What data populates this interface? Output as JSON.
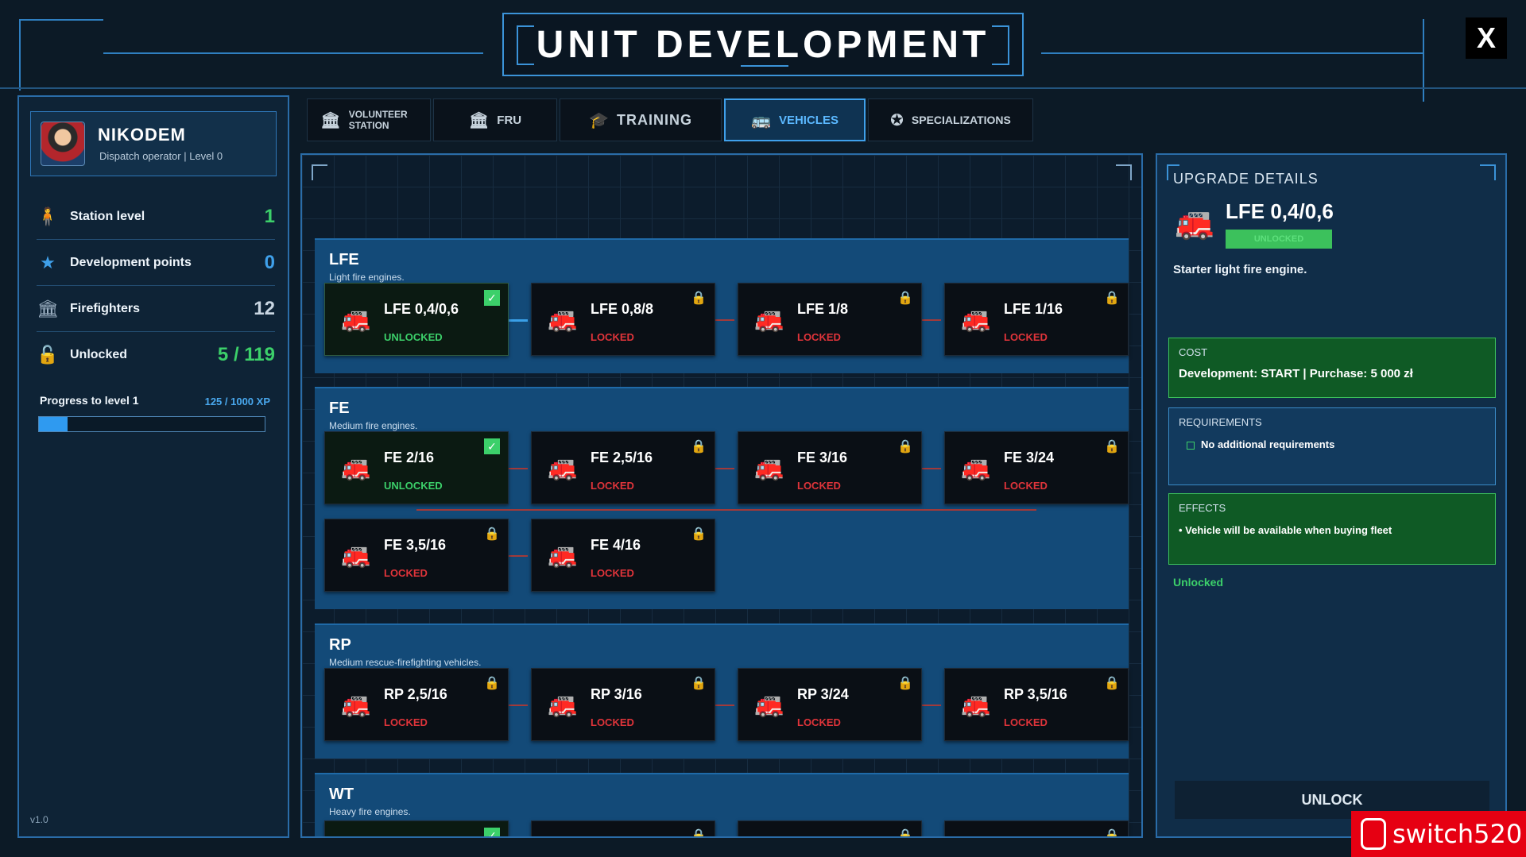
{
  "header": {
    "title": "UNIT DEVELOPMENT",
    "close_label": "X"
  },
  "profile": {
    "name": "NIKODEM",
    "subtitle": "Dispatch operator | Level 0"
  },
  "stats": [
    {
      "label": "Station level",
      "value": "1",
      "color": "#3cd06a",
      "icon": "firefighter-icon"
    },
    {
      "label": "Development points",
      "value": "0",
      "color": "#3fa0ea",
      "icon": "star-icon"
    },
    {
      "label": "Firefighters",
      "value": "12",
      "color": "#c9d6e2",
      "icon": "building-icon"
    },
    {
      "label": "Unlocked",
      "value": "5 / 119",
      "color": "#3cd06a",
      "icon": "lock-open-icon"
    }
  ],
  "progress": {
    "label": "Progress to level 1",
    "xp_text": "125 / 1000 XP",
    "fraction": 0.125
  },
  "version": "v1.0",
  "tabs": [
    {
      "label": "VOLUNTEER STATION",
      "icon": "station-icon",
      "active": false
    },
    {
      "label": "FRU",
      "icon": "station-icon",
      "active": false
    },
    {
      "label": "TRAINING",
      "icon": "graduation-cap-icon",
      "active": false
    },
    {
      "label": "VEHICLES",
      "icon": "bus-icon",
      "active": true
    },
    {
      "label": "SPECIALIZATIONS",
      "icon": "star-badge-icon",
      "active": false
    }
  ],
  "groups": [
    {
      "name": "LFE",
      "desc": "Light fire engines.",
      "nodes": [
        {
          "name": "LFE 0,4/0,6",
          "status": "UNLOCKED",
          "selected": true
        },
        {
          "name": "LFE 0,8/8",
          "status": "LOCKED"
        },
        {
          "name": "LFE 1/8",
          "status": "LOCKED"
        },
        {
          "name": "LFE 1/16",
          "status": "LOCKED"
        }
      ]
    },
    {
      "name": "FE",
      "desc": "Medium fire engines.",
      "nodes": [
        {
          "name": "FE 2/16",
          "status": "UNLOCKED"
        },
        {
          "name": "FE 2,5/16",
          "status": "LOCKED"
        },
        {
          "name": "FE 3/16",
          "status": "LOCKED"
        },
        {
          "name": "FE 3/24",
          "status": "LOCKED"
        },
        {
          "name": "FE 3,5/16",
          "status": "LOCKED"
        },
        {
          "name": "FE 4/16",
          "status": "LOCKED"
        }
      ]
    },
    {
      "name": "RP",
      "desc": "Medium rescue-firefighting vehicles.",
      "nodes": [
        {
          "name": "RP 2,5/16",
          "status": "LOCKED"
        },
        {
          "name": "RP 3/16",
          "status": "LOCKED"
        },
        {
          "name": "RP 3/24",
          "status": "LOCKED"
        },
        {
          "name": "RP 3,5/16",
          "status": "LOCKED"
        }
      ]
    },
    {
      "name": "WT",
      "desc": "Heavy fire engines.",
      "nodes": []
    }
  ],
  "details": {
    "title": "UPGRADE DETAILS",
    "name": "LFE 0,4/0,6",
    "badge": "UNLOCKED",
    "description": "Starter light fire engine.",
    "cost_caption": "COST",
    "cost_text": "Development: START | Purchase: 5 000 zł",
    "req_caption": "REQUIREMENTS",
    "req_text": "No additional requirements",
    "effects_caption": "EFFECTS",
    "effects_text": "• Vehicle will be available when buying fleet",
    "status_text": "Unlocked",
    "unlock_label": "UNLOCK"
  },
  "watermark": "switch520",
  "colors": {
    "unlocked": "#3cd06a",
    "locked": "#e0343a",
    "accent": "#3fa0ea"
  }
}
